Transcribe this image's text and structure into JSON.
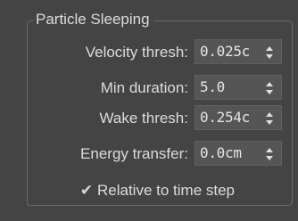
{
  "group": {
    "title": "Particle Sleeping"
  },
  "fields": [
    {
      "label": "Velocity thresh:",
      "value": "0.025c"
    },
    {
      "label": "Min duration:",
      "value": "5.0"
    },
    {
      "label": "Wake thresh:",
      "value": "0.254c"
    },
    {
      "label": "Energy transfer:",
      "value": "0.0cm"
    }
  ],
  "checkbox": {
    "label": "Relative to time step",
    "checked": true
  },
  "icons": {
    "spinner_arrows": "up-down-spinner-icon",
    "check": "checkmark-icon"
  }
}
